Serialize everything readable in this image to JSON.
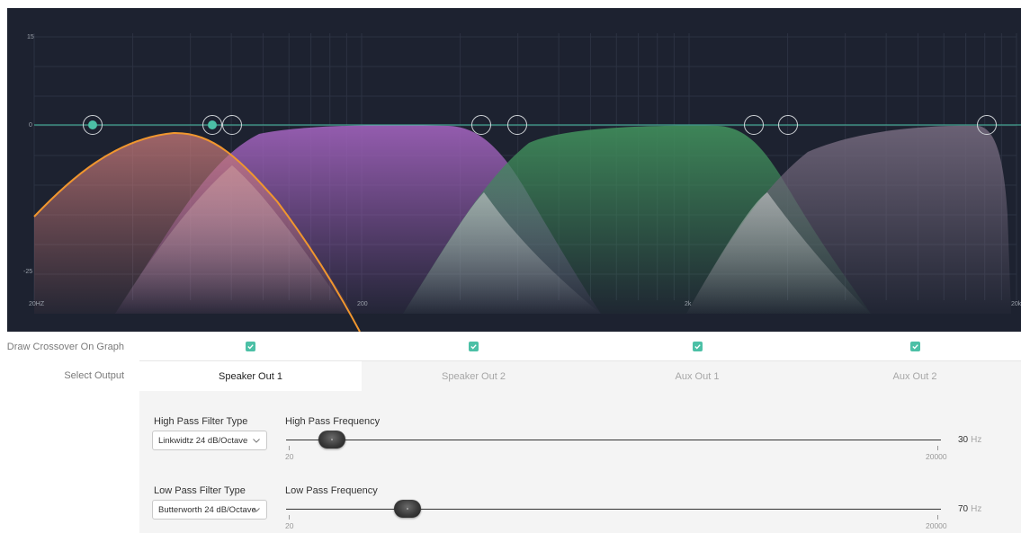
{
  "graph": {
    "y_top_label": "15",
    "y_zero_label": "0",
    "y_bottom_label": "-25",
    "x_labels": [
      "20HZ",
      "200",
      "2k",
      "20k"
    ]
  },
  "crossover_row": {
    "label": "Draw Crossover On Graph",
    "checked": [
      true,
      true,
      true,
      true
    ]
  },
  "output_row": {
    "label": "Select Output",
    "tabs": [
      {
        "label": "Speaker Out 1",
        "active": true
      },
      {
        "label": "Speaker Out 2",
        "active": false
      },
      {
        "label": "Aux Out 1",
        "active": false
      },
      {
        "label": "Aux Out 2",
        "active": false
      }
    ]
  },
  "high_pass": {
    "type_label": "High Pass Filter Type",
    "type_value": "Linkwidtz 24 dB/Octave",
    "freq_label": "High Pass Frequency",
    "min": "20",
    "max": "20000",
    "value": "30",
    "unit": "Hz",
    "position_fraction": 0.07
  },
  "low_pass": {
    "type_label": "Low Pass Filter Type",
    "type_value": "Butterworth 24 dB/Octave",
    "freq_label": "Low Pass Frequency",
    "min": "20",
    "max": "20000",
    "value": "70",
    "unit": "Hz",
    "position_fraction": 0.185
  },
  "colors": {
    "graph_bg": "#1d2230",
    "zero_line": "#4cc0a6",
    "accent_check": "#4cc0a6",
    "speaker_out_1": "#c97a7a",
    "speaker_out_1_curve": "#f0962e",
    "speaker_out_2": "#9a5fb5",
    "aux_out_1": "#3f8a5a",
    "aux_out_2": "#6e6478"
  }
}
